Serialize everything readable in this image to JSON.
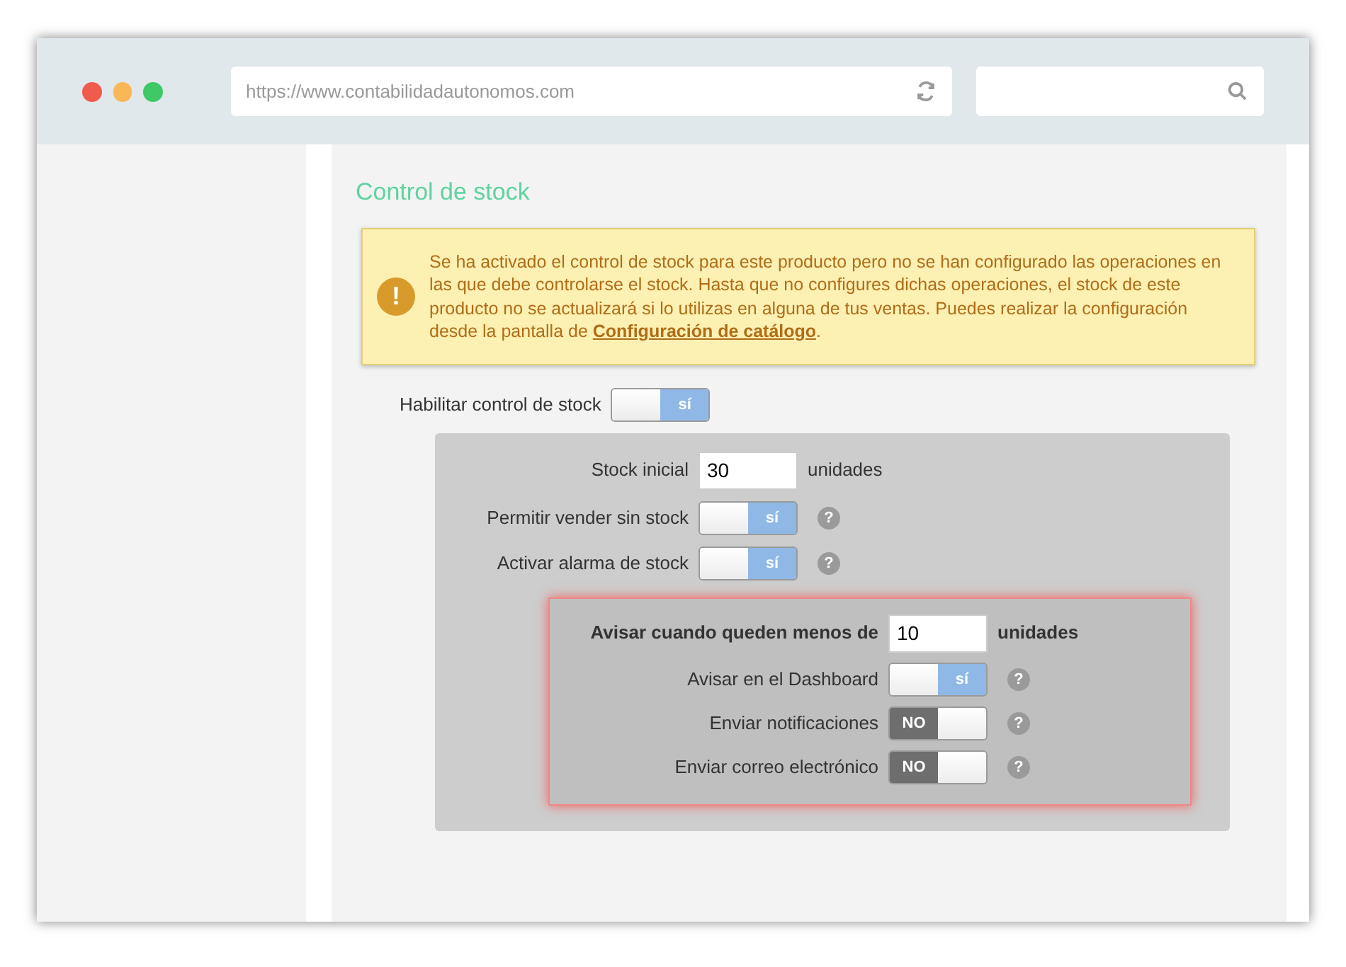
{
  "browser": {
    "url": "https://www.contabilidadautonomos.com"
  },
  "section_title": "Control de stock",
  "alert": {
    "icon": "!",
    "text_before": "Se ha activado el control de stock para este producto pero no se han configurado las operaciones en las que debe controlarse el stock. Hasta que no configures dichas operaciones, el stock de este producto no se actualizará si lo utilizas en alguna de tus ventas. Puedes realizar la configuración desde la pantalla de ",
    "link": "Configuración de catálogo",
    "text_after": "."
  },
  "enable": {
    "label": "Habilitar control de stock",
    "toggle": {
      "on": true,
      "label": "sí"
    }
  },
  "settings": [
    {
      "kind": "input",
      "label": "Stock inicial",
      "value": "30",
      "unit": "unidades"
    },
    {
      "kind": "toggle",
      "label": "Permitir vender sin stock",
      "on": true,
      "toggle_label": "sí",
      "help": "?"
    },
    {
      "kind": "toggle",
      "label": "Activar alarma de stock",
      "on": true,
      "toggle_label": "sí",
      "help": "?"
    }
  ],
  "alarm_settings": [
    {
      "kind": "input",
      "label": "Avisar cuando queden menos de",
      "value": "10",
      "unit": "unidades"
    },
    {
      "kind": "toggle",
      "label": "Avisar en el Dashboard",
      "on": true,
      "toggle_label": "sí",
      "help": "?"
    },
    {
      "kind": "toggle",
      "label": "Enviar notificaciones",
      "on": false,
      "toggle_label": "NO",
      "help": "?"
    },
    {
      "kind": "toggle",
      "label": "Enviar correo electrónico",
      "on": false,
      "toggle_label": "NO",
      "help": "?"
    }
  ]
}
